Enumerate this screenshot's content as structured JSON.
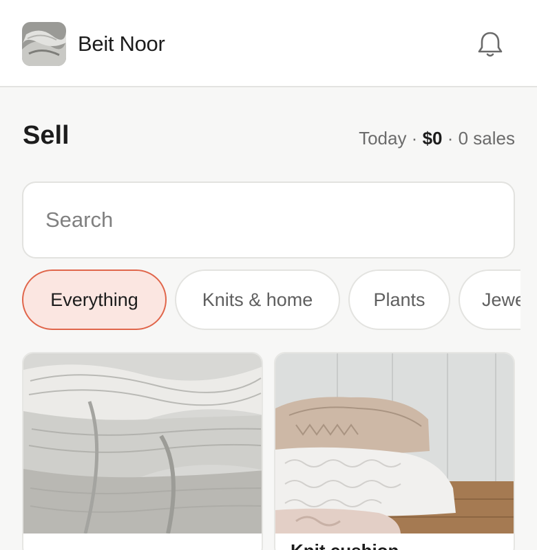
{
  "header": {
    "brand_name": "Beit Noor",
    "logo_icon": "knit-blanket-logo",
    "notification_icon": "bell-icon"
  },
  "page": {
    "title": "Sell",
    "summary_prefix": "Today · ",
    "summary_amount": "$0",
    "summary_suffix": " · 0 sales"
  },
  "search": {
    "placeholder": "Search",
    "value": ""
  },
  "categories": {
    "items": [
      "Everything",
      "Knits & home",
      "Plants",
      "Jewelry"
    ],
    "selected": "Everything"
  },
  "products": [
    {
      "title": "",
      "image": "grey-knit-blanket-photo"
    },
    {
      "title": "Knit cushion",
      "image": "folded-knits-stack-photo"
    }
  ],
  "colors": {
    "accent": "#e0654a",
    "accent_bg": "#fbe6e1"
  }
}
